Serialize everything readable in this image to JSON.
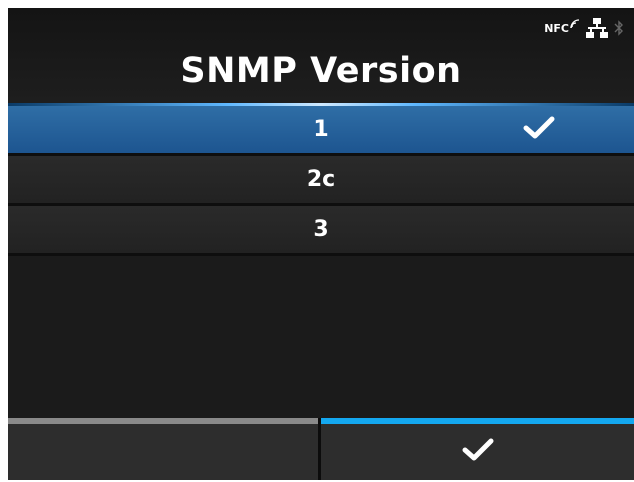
{
  "header": {
    "title": "SNMP Version",
    "status": {
      "nfc_label": "NFC"
    }
  },
  "list": {
    "items": [
      {
        "label": "1",
        "selected": true
      },
      {
        "label": "2c",
        "selected": false
      },
      {
        "label": "3",
        "selected": false
      }
    ]
  },
  "colors": {
    "selected_row": "#1d5590",
    "accent": "#14a8f0"
  },
  "icons": [
    "nfc-icon",
    "network-icon",
    "bluetooth-icon",
    "checkmark-icon"
  ]
}
